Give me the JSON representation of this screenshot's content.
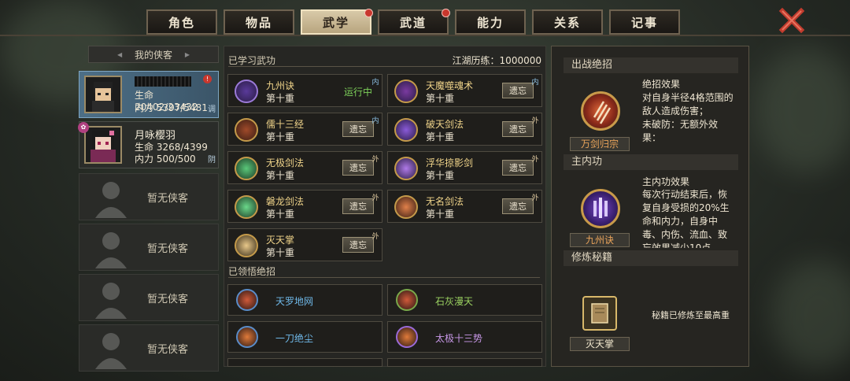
{
  "tabs": [
    {
      "label": "角色",
      "active": false,
      "badge": false
    },
    {
      "label": "物品",
      "active": false,
      "badge": false
    },
    {
      "label": "武学",
      "active": true,
      "badge": true
    },
    {
      "label": "武道",
      "active": false,
      "badge": true
    },
    {
      "label": "能力",
      "active": false,
      "badge": false
    },
    {
      "label": "关系",
      "active": false,
      "badge": false
    },
    {
      "label": "记事",
      "active": false,
      "badge": false
    }
  ],
  "left": {
    "header": "我的侠客",
    "heroes": [
      {
        "name": "",
        "hp": "生命 20402/23432",
        "mp": "内力 5397/5481",
        "tag": "调",
        "selected": true
      },
      {
        "name": "月咏樱羽",
        "hp": "生命 3268/4399",
        "mp": "内力 500/500",
        "tag": "阴",
        "selected": false
      }
    ],
    "empty_label": "暂无侠客"
  },
  "mid": {
    "learned_title": "已学习武功",
    "exp": "江湖历练：1000000",
    "skills": [
      {
        "name": "九州诀",
        "level": "第十重",
        "status": "运行中",
        "btn": "",
        "type": "内",
        "icon": "purple-pillars-icon"
      },
      {
        "name": "天魔噬魂术",
        "level": "第十重",
        "status": "",
        "btn": "遗忘",
        "type": "内",
        "icon": "purple-vortex-icon"
      },
      {
        "name": "儒十三经",
        "level": "第十重",
        "status": "",
        "btn": "遗忘",
        "type": "内",
        "icon": "scholar-icon"
      },
      {
        "name": "破天剑法",
        "level": "第十重",
        "status": "",
        "btn": "遗忘",
        "type": "外",
        "icon": "purple-sword-icon"
      },
      {
        "name": "无极剑法",
        "level": "第十重",
        "status": "",
        "btn": "遗忘",
        "type": "外",
        "icon": "green-sword-icon"
      },
      {
        "name": "浮华掠影剑",
        "level": "第十重",
        "status": "",
        "btn": "遗忘",
        "type": "外",
        "icon": "violet-sword-icon"
      },
      {
        "name": "磐龙剑法",
        "level": "第十重",
        "status": "",
        "btn": "遗忘",
        "type": "外",
        "icon": "green-dragon-icon"
      },
      {
        "name": "无名剑法",
        "level": "第十重",
        "status": "",
        "btn": "遗忘",
        "type": "外",
        "icon": "orange-slash-icon"
      },
      {
        "name": "灭天掌",
        "level": "第十重",
        "status": "",
        "btn": "遗忘",
        "type": "外",
        "icon": "palm-icon"
      }
    ],
    "ult_title": "已领悟绝招",
    "ults": [
      {
        "name": "天罗地网",
        "color": "#6fb8e8",
        "icon": "net-icon"
      },
      {
        "name": "石灰漫天",
        "color": "#9ad060",
        "icon": "dust-icon"
      },
      {
        "name": "一刀绝尘",
        "color": "#6fb8e8",
        "icon": "blade-icon"
      },
      {
        "name": "太极十三势",
        "color": "#c898e8",
        "icon": "taiji-icon"
      }
    ]
  },
  "right": {
    "sec1": {
      "title": "出战绝招",
      "caption": "万剑归宗",
      "effect_title": "绝招效果",
      "effect": "对自身半径4格范围的敌人造成伤害；\n未破防：无额外效果："
    },
    "sec2": {
      "title": "主内功",
      "caption": "九州诀",
      "effect_title": "主内功效果",
      "effect": "每次行动结束后，恢复自身受损的20%生命和内力，自身中毒、内伤、流血、致忘效果减少10点"
    },
    "sec3": {
      "title": "修炼秘籍",
      "caption": "灭天掌",
      "note": "秘籍已修炼至最高重"
    }
  }
}
